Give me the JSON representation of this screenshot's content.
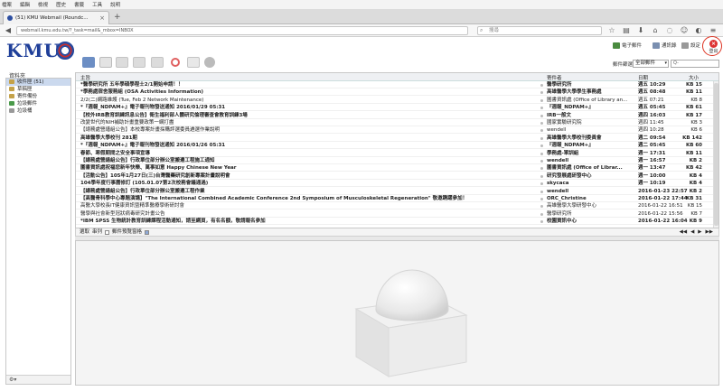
{
  "browser": {
    "menu": [
      "檔案",
      "編輯",
      "檢視",
      "歷史",
      "書籤",
      "工具",
      "說明"
    ],
    "tab_title": "(51) KMU Webmail (Roundc...",
    "url": "webmail.kmu.edu.tw/?_task=mail&_mbox=INBOX",
    "search_placeholder": "搜尋"
  },
  "header": {
    "logo_text": "KMU",
    "links": {
      "compose": "電子郵件",
      "addressbook": "通訊錄",
      "settings": "設定",
      "logout": "登出"
    }
  },
  "toolbar": {
    "filter_label": "郵件篩選",
    "filter_value": "全部郵件",
    "search_placeholder": "Q-"
  },
  "sidebar": {
    "heading": "資料夾",
    "folders": [
      {
        "label": "收件匣 (51)",
        "selected": true
      },
      {
        "label": "草稿匣",
        "selected": false
      },
      {
        "label": "寄件備份",
        "selected": false
      },
      {
        "label": "垃圾郵件",
        "selected": false
      },
      {
        "label": "垃圾桶",
        "selected": false
      }
    ],
    "footer_icon": "gear-icon"
  },
  "list": {
    "columns": {
      "subject": "主旨",
      "from": "寄件者",
      "date": "日期",
      "size": "大小"
    },
    "rows": [
      {
        "subject": "*醫學研究所 五年學碩學程士2/1開始申請！！",
        "from": "醫學研究所",
        "date": "週五 10:29",
        "size": "15 KB",
        "unread": true
      },
      {
        "subject": "*學務處宿舍服務組 (OSA Activities Information)",
        "from": "高雄醫學大學學生事務處",
        "date": "週五 08:48",
        "size": "11 KB",
        "unread": true
      },
      {
        "subject": "2/2(二)網路維護 (Tue, Feb 2 Network Maintenance)",
        "from": "圖書資訊處 (Office of Library an...",
        "date": "週五 07:21",
        "size": "8 KB",
        "unread": false
      },
      {
        "subject": "*『週報_NDPAM+』電子報刊物發送通知 2016/01/29 05:31",
        "from": "『週報_NDPAM+』",
        "date": "週五 05:45",
        "size": "61 KB",
        "unread": true
      },
      {
        "subject": "【校外IRB教育訓練訊息公告】衛生福利部人體研究倫理審查會教育訓練3場",
        "from": "IRB一般文",
        "date": "週四 16:03",
        "size": "17 KB",
        "unread": true
      },
      {
        "subject": "改變世代的NIH補助計畫重要政策一網打盡",
        "from": "國家實驗研究院",
        "date": "週四 11:45",
        "size": "3 KB",
        "unread": false
      },
      {
        "subject": "【總務處營繕組公告】本校專案計畫採購評選委員遴選作業說明",
        "from": "wendell",
        "date": "週四 10:28",
        "size": "6 KB",
        "unread": false
      },
      {
        "subject": "高雄醫學大學校刊 281期",
        "from": "高雄醫學大學校刊委員會",
        "date": "週二 09:54",
        "size": "142 KB",
        "unread": true
      },
      {
        "subject": "*『週報_NDPAM+』電子報刊物發送通知 2016/01/26 05:31",
        "from": "『週報_NDPAM+』",
        "date": "週二 05:45",
        "size": "60 KB",
        "unread": true
      },
      {
        "subject": "春節、寒假期間之安全事項宣導",
        "from": "學務處-軍訓組",
        "date": "週一 17:31",
        "size": "11 KB",
        "unread": true
      },
      {
        "subject": "【總務處營繕組公告】行政單位部分辦公室搬遷工程施工通知",
        "from": "wendell",
        "date": "週一 16:57",
        "size": "2 KB",
        "unread": true
      },
      {
        "subject": "圖書資訊處祝福您新年快樂、萬事如意 Happy Chinese New Year",
        "from": "圖書資訊處 (Office of Librar...",
        "date": "週一 13:47",
        "size": "42 KB",
        "unread": true
      },
      {
        "subject": "【活動公告】105年1月27日(三)台灣醫藥研究創新專案計畫說明會",
        "from": "研究發展處研發中心",
        "date": "週一 10:00",
        "size": "4 KB",
        "unread": true
      },
      {
        "subject": "104學年度行事曆修訂 (105.01.07第2次校務會議通過)",
        "from": "skycaca",
        "date": "週一 10:19",
        "size": "4 KB",
        "unread": true
      },
      {
        "subject": "【總務處營繕組公告】行政單位部分辦公室搬遷工程作業",
        "from": "wendell",
        "date": "2016-01-23 22:57",
        "size": "2 KB",
        "unread": true
      },
      {
        "subject": "【高醫骨科學中心專題演講】\"The International Combined Academic Conference 2nd Symposium of Musculoskeletal Regeneration\" 敬邀踴躍參加！",
        "from": "ORC_Christine",
        "date": "2016-01-22 17:44",
        "size": "31 KB",
        "unread": true
      },
      {
        "subject": "高醫大學校長IT健康資訊暨精準醫療學術研討會",
        "from": "高雄醫學大學研發中心",
        "date": "2016-01-22 16:51",
        "size": "15 KB",
        "unread": false
      },
      {
        "subject": "醫學與社會新型冠狀病毒研究計畫公告",
        "from": "醫學研究所",
        "date": "2016-01-22 15:56",
        "size": "7 KB",
        "unread": false
      },
      {
        "subject": "*IBM SPSS 生物統計教育訓練課程活動通知，請至網頁，有名名額，敬請報名參加",
        "from": "校園資訊中心",
        "date": "2016-01-22 16:04",
        "size": "9 KB",
        "unread": true
      }
    ]
  },
  "pager": {
    "select_label": "選取",
    "thread_label": "串列",
    "preview_label": "郵件預覽窗格",
    "page_text": "1 / 3"
  }
}
